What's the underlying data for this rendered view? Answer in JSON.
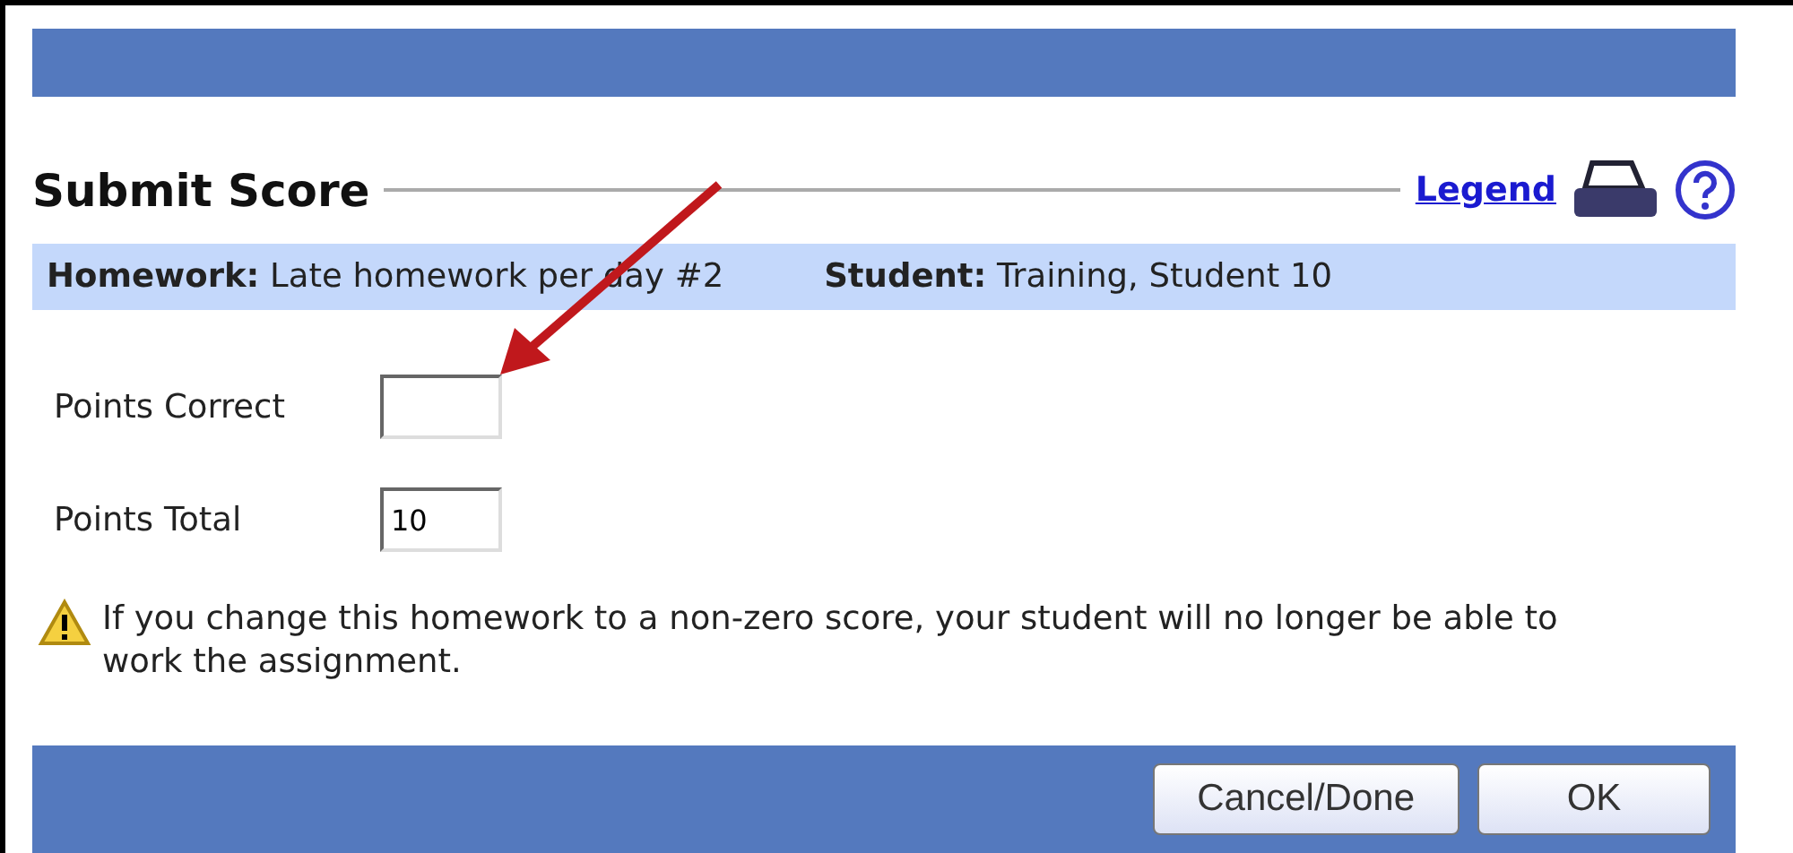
{
  "dialog": {
    "title": "Submit Score",
    "legend_link": "Legend"
  },
  "info": [
    {
      "label": "Homework:",
      "value": "Late homework per day #2"
    },
    {
      "label": "Student:",
      "value": "Training, Student 10"
    }
  ],
  "fields": [
    {
      "label": "Points Correct"
    },
    {
      "label": "Points Total",
      "value": "10"
    }
  ],
  "warning": "If you change this homework to a non-zero score, your student will no longer be able to work the assignment.",
  "buttons": [
    "Cancel/Done",
    "OK"
  ]
}
